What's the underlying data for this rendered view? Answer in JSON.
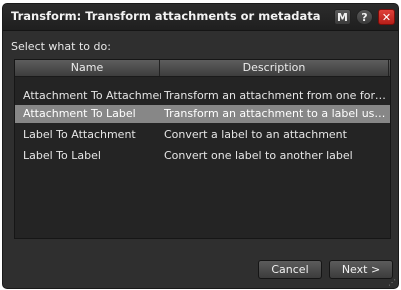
{
  "window": {
    "title": "Transform: Transform attachments or metadata",
    "m_label": "M",
    "help_label": "?",
    "close_label": "✕"
  },
  "prompt": "Select what to do:",
  "table": {
    "columns": [
      "Name",
      "Description"
    ],
    "rows": [
      {
        "name": "Attachment To Attachment",
        "description": "Transform an attachment from one form to...",
        "selected": false
      },
      {
        "name": "Attachment To Label",
        "description": "Transform an attachment to a label using X...",
        "selected": true
      },
      {
        "name": "Label To Attachment",
        "description": "Convert a label to an attachment",
        "selected": false
      },
      {
        "name": "Label To Label",
        "description": "Convert one label to another label",
        "selected": false
      }
    ]
  },
  "buttons": {
    "cancel": "Cancel",
    "next": "Next >"
  },
  "colors": {
    "dialog_bg": "#2f2f2f",
    "selection": "#878787",
    "close_button": "#c8302a"
  },
  "icons": [
    "m-icon",
    "help-icon",
    "close-icon",
    "resize-grip-icon"
  ]
}
